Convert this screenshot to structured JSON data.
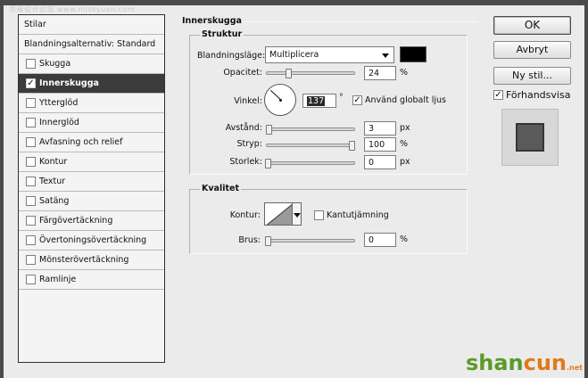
{
  "watermark": "思缘设计论坛 www.missyuan.com",
  "style_list": {
    "header": "Stilar",
    "blend_options": "Blandningsalternativ: Standard",
    "items": [
      {
        "label": "Skugga",
        "checked": false,
        "indent": false,
        "selected": false
      },
      {
        "label": "Innerskugga",
        "checked": true,
        "indent": false,
        "selected": true
      },
      {
        "label": "Ytterglöd",
        "checked": false,
        "indent": false,
        "selected": false
      },
      {
        "label": "Innerglöd",
        "checked": false,
        "indent": false,
        "selected": false
      },
      {
        "label": "Avfasning och relief",
        "checked": false,
        "indent": false,
        "selected": false
      },
      {
        "label": "Kontur",
        "checked": false,
        "indent": true,
        "selected": false
      },
      {
        "label": "Textur",
        "checked": false,
        "indent": true,
        "selected": false
      },
      {
        "label": "Satäng",
        "checked": false,
        "indent": false,
        "selected": false
      },
      {
        "label": "Färgövertäckning",
        "checked": false,
        "indent": false,
        "selected": false
      },
      {
        "label": "Övertoningsövertäckning",
        "checked": false,
        "indent": false,
        "selected": false
      },
      {
        "label": "Mönsterövertäckning",
        "checked": false,
        "indent": false,
        "selected": false
      },
      {
        "label": "Ramlinje",
        "checked": false,
        "indent": false,
        "selected": false
      }
    ]
  },
  "panel": {
    "title": "Innerskugga",
    "structure": {
      "title": "Struktur",
      "blend_mode_label": "Blandningsläge:",
      "blend_mode_value": "Multiplicera",
      "shadow_color": "#000000",
      "opacity_label": "Opacitet:",
      "opacity_value": "24",
      "opacity_level": 0.24,
      "opacity_unit": "%",
      "angle_label": "Vinkel:",
      "angle_value": "137",
      "angle_degrees": 137,
      "angle_unit": "°",
      "global_light_label": "Använd globalt ljus",
      "global_light_checked": true,
      "distance_label": "Avstånd:",
      "distance_value": "3",
      "distance_level": 0.01,
      "distance_unit": "px",
      "choke_label": "Stryp:",
      "choke_value": "100",
      "choke_level": 1.0,
      "choke_unit": "%",
      "size_label": "Storlek:",
      "size_value": "0",
      "size_level": 0,
      "size_unit": "px"
    },
    "quality": {
      "title": "Kvalitet",
      "contour_label": "Kontur:",
      "antialias_label": "Kantutjämning",
      "antialias_checked": false,
      "noise_label": "Brus:",
      "noise_value": "0",
      "noise_level": 0,
      "noise_unit": "%"
    }
  },
  "buttons": {
    "ok": "OK",
    "cancel": "Avbryt",
    "new_style": "Ny stil...",
    "preview_label": "Förhandsvisa",
    "preview_checked": true
  },
  "logo": {
    "text_main": "shan",
    "text_accent": "cun",
    "text_sub": ".net"
  }
}
